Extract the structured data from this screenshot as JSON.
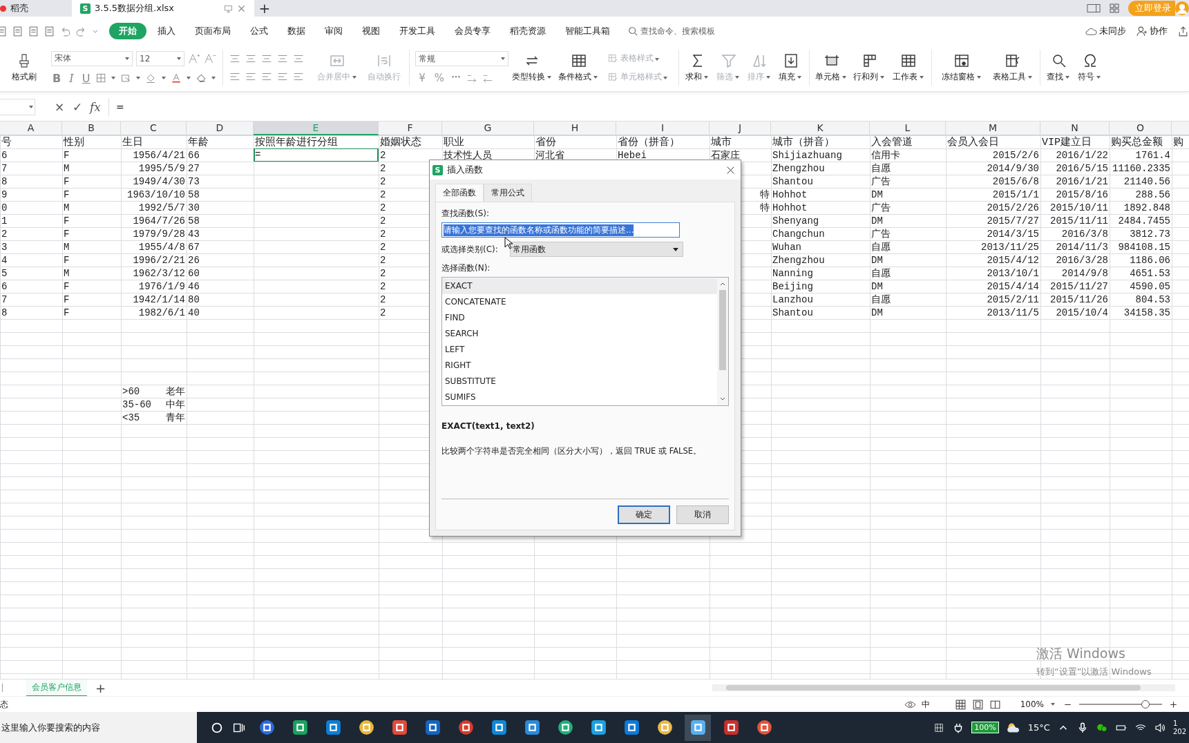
{
  "title_bar": {
    "tabs": [
      {
        "label": "稻壳",
        "selected": false
      },
      {
        "label": "3.5.5数据分组.xlsx",
        "selected": true
      }
    ],
    "logo_letter": "S",
    "new_tab": "+",
    "login": "立即登录"
  },
  "menu": {
    "tabs": [
      {
        "label": "开始",
        "selected": true
      },
      {
        "label": "插入",
        "selected": false
      },
      {
        "label": "页面布局",
        "selected": false
      },
      {
        "label": "公式",
        "selected": false
      },
      {
        "label": "数据",
        "selected": false
      },
      {
        "label": "审阅",
        "selected": false
      },
      {
        "label": "视图",
        "selected": false
      },
      {
        "label": "开发工具",
        "selected": false
      },
      {
        "label": "会员专享",
        "selected": false
      },
      {
        "label": "稻壳资源",
        "selected": false
      },
      {
        "label": "智能工具箱",
        "selected": false
      }
    ],
    "search_placeholder": "查找命令、搜索模板",
    "sync": "未同步",
    "collab": "协作"
  },
  "ribbon": {
    "format_painter": "格式刷",
    "font": "宋体",
    "font_size": "12",
    "text_styles": [
      "B",
      "I",
      "U"
    ],
    "number_format": "常规",
    "number_buttons": [
      "¥",
      "%"
    ],
    "tools": [
      {
        "label": "合并居中",
        "kind": "large",
        "disabled": true,
        "menu": true
      },
      {
        "label": "自动换行",
        "kind": "large",
        "disabled": true,
        "menu": false
      },
      {
        "label": "类型转换",
        "kind": "large",
        "disabled": false,
        "menu": true
      },
      {
        "label": "条件格式",
        "kind": "large",
        "disabled": false,
        "menu": true
      },
      {
        "label": "表格样式",
        "kind": "small",
        "disabled": true,
        "menu": true
      },
      {
        "label": "单元格样式",
        "kind": "small",
        "disabled": true,
        "menu": true
      },
      {
        "label": "求和",
        "kind": "large",
        "disabled": false,
        "menu": true
      },
      {
        "label": "筛选",
        "kind": "large",
        "disabled": true,
        "menu": true
      },
      {
        "label": "排序",
        "kind": "large",
        "disabled": true,
        "menu": true
      },
      {
        "label": "填充",
        "kind": "large",
        "disabled": false,
        "menu": true
      },
      {
        "label": "单元格",
        "kind": "large",
        "disabled": false,
        "menu": true
      },
      {
        "label": "行和列",
        "kind": "large",
        "disabled": false,
        "menu": true
      },
      {
        "label": "工作表",
        "kind": "large",
        "disabled": false,
        "menu": true
      },
      {
        "label": "冻结窗格",
        "kind": "large",
        "disabled": false,
        "menu": true
      },
      {
        "label": "表格工具",
        "kind": "large",
        "disabled": false,
        "menu": true
      },
      {
        "label": "查找",
        "kind": "large",
        "disabled": false,
        "menu": true
      },
      {
        "label": "符号",
        "kind": "large",
        "disabled": false,
        "menu": true
      }
    ]
  },
  "formula_bar": {
    "cancel": "×",
    "confirm": "✓",
    "fx": "fx",
    "content": "="
  },
  "sheet": {
    "columns": [
      {
        "letter": "A",
        "selected": false
      },
      {
        "letter": "B",
        "selected": false
      },
      {
        "letter": "C",
        "selected": false
      },
      {
        "letter": "D",
        "selected": false
      },
      {
        "letter": "E",
        "selected": true
      },
      {
        "letter": "F",
        "selected": false
      },
      {
        "letter": "G",
        "selected": false
      },
      {
        "letter": "H",
        "selected": false
      },
      {
        "letter": "I",
        "selected": false
      },
      {
        "letter": "J",
        "selected": false
      },
      {
        "letter": "K",
        "selected": false
      },
      {
        "letter": "L",
        "selected": false
      },
      {
        "letter": "M",
        "selected": false
      },
      {
        "letter": "N",
        "selected": false
      },
      {
        "letter": "O",
        "selected": false
      }
    ],
    "rows": [
      {
        "cells": [
          "号",
          "性别",
          "生日",
          "年龄",
          "按照年龄进行分组",
          "婚姻状态",
          "职业",
          "省份",
          "省份（拼音）",
          "城市",
          "城市（拼音）",
          "入会管道",
          "会员入会日",
          "VIP建立日",
          "购买总金额",
          "购"
        ]
      },
      {
        "cells": [
          "6",
          "F",
          "1956/4/21",
          "66",
          {
            "text": "=",
            "selected": true
          },
          "2",
          "技术性人员",
          "河北省",
          "Hebei",
          "石家庄",
          "Shijiazhuang",
          "信用卡",
          "2015/2/6",
          "2016/1/22",
          "1761.4",
          null
        ]
      },
      {
        "cells": [
          "7",
          "M",
          "1995/5/9",
          "27",
          null,
          "2",
          null,
          null,
          null,
          null,
          "Zhengzhou",
          "自愿",
          "2014/9/30",
          "2016/5/15",
          "11160.2335",
          null
        ]
      },
      {
        "cells": [
          "8",
          "F",
          "1949/4/30",
          "73",
          null,
          "2",
          null,
          null,
          null,
          null,
          "Shantou",
          "广告",
          "2015/6/8",
          "2016/1/21",
          "21140.56",
          null
        ]
      },
      {
        "cells": [
          "9",
          "F",
          "1963/10/10",
          "58",
          null,
          "2",
          null,
          null,
          null,
          "特",
          "Hohhot",
          "DM",
          "2015/1/1",
          "2015/8/16",
          "288.56",
          null
        ]
      },
      {
        "cells": [
          "0",
          "M",
          "1992/5/7",
          "30",
          null,
          "2",
          null,
          null,
          null,
          "特",
          "Hohhot",
          "广告",
          "2015/2/26",
          "2015/10/11",
          "1892.848",
          null
        ]
      },
      {
        "cells": [
          "1",
          "F",
          "1964/7/26",
          "58",
          null,
          "2",
          null,
          null,
          null,
          null,
          "Shenyang",
          "DM",
          "2015/7/27",
          "2015/11/11",
          "2484.7455",
          null
        ]
      },
      {
        "cells": [
          "2",
          "F",
          "1979/9/28",
          "43",
          null,
          "2",
          null,
          null,
          null,
          null,
          "Changchun",
          "广告",
          "2014/3/15",
          "2016/3/8",
          "3812.73",
          null
        ]
      },
      {
        "cells": [
          "3",
          "M",
          "1955/4/8",
          "67",
          null,
          "2",
          null,
          null,
          null,
          null,
          "Wuhan",
          "自愿",
          "2013/11/25",
          "2014/11/3",
          "984108.15",
          null
        ]
      },
      {
        "cells": [
          "4",
          "F",
          "1996/2/21",
          "26",
          null,
          "2",
          null,
          null,
          null,
          null,
          "Zhengzhou",
          "DM",
          "2015/4/12",
          "2016/3/28",
          "1186.06",
          null
        ]
      },
      {
        "cells": [
          "5",
          "M",
          "1962/3/12",
          "60",
          null,
          "2",
          null,
          null,
          null,
          null,
          "Nanning",
          "自愿",
          "2013/10/1",
          "2014/9/8",
          "4651.53",
          null
        ]
      },
      {
        "cells": [
          "6",
          "F",
          "1976/1/9",
          "46",
          null,
          "2",
          null,
          null,
          null,
          null,
          "Beijing",
          "DM",
          "2015/4/14",
          "2015/11/27",
          "4590.05",
          null
        ]
      },
      {
        "cells": [
          "7",
          "F",
          "1942/1/14",
          "80",
          null,
          "2",
          null,
          null,
          null,
          null,
          "Lanzhou",
          "自愿",
          "2015/2/11",
          "2015/11/26",
          "804.53",
          null
        ]
      },
      {
        "cells": [
          "8",
          "F",
          "1982/6/1",
          "40",
          null,
          "2",
          null,
          null,
          null,
          null,
          "Shantou",
          "DM",
          "2013/11/5",
          "2015/10/4",
          "34158.35",
          null
        ]
      }
    ],
    "age_groups": [
      {
        "range": ">60",
        "label": "老年"
      },
      {
        "range": "35-60",
        "label": "中年"
      },
      {
        "range": "<35",
        "label": "青年"
      }
    ],
    "sheet_tabs": [
      {
        "label": "会员客户信息",
        "selected": true
      }
    ],
    "add_sheet": "+"
  },
  "dialog": {
    "title": "插入函数",
    "logo_letter": "S",
    "tabs": [
      {
        "label": "全部函数",
        "selected": true
      },
      {
        "label": "常用公式",
        "selected": false
      }
    ],
    "search_label": "查找函数(S):",
    "search_value": "请输入您要查找的函数名称或函数功能的简要描述...",
    "category_label": "或选择类别(C):",
    "category": "常用函数",
    "list_label": "选择函数(N):",
    "functions": [
      {
        "name": "EXACT",
        "selected": true
      },
      {
        "name": "CONCATENATE",
        "selected": false
      },
      {
        "name": "FIND",
        "selected": false
      },
      {
        "name": "SEARCH",
        "selected": false
      },
      {
        "name": "LEFT",
        "selected": false
      },
      {
        "name": "RIGHT",
        "selected": false
      },
      {
        "name": "SUBSTITUTE",
        "selected": false
      },
      {
        "name": "SUMIFS",
        "selected": false
      }
    ],
    "signature": "EXACT(text1, text2)",
    "description": "比较两个字符串是否完全相同（区分大小写），返回 TRUE 或 FALSE。",
    "buttons": [
      "确定",
      "取消"
    ]
  },
  "activation": {
    "title": "激活 Windows",
    "hint": "转到“设置”以激活 Windows"
  },
  "status_bar": {
    "left": "态",
    "input_mode": "中",
    "zoom": "100%",
    "zoom_slider": {
      "level": 0.8
    }
  },
  "taskbar": {
    "search": "这里输入你要搜索的内容",
    "battery": "100%",
    "weather": "15°C",
    "clock": [
      "1",
      "202"
    ]
  }
}
